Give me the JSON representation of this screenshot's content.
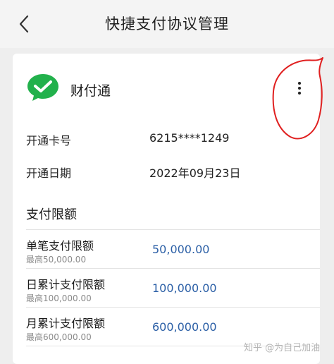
{
  "header": {
    "title": "快捷支付协议管理"
  },
  "provider": {
    "name": "财付通"
  },
  "info": [
    {
      "label": "开通卡号",
      "value": "6215****1249"
    },
    {
      "label": "开通日期",
      "value": "2022年09月23日"
    }
  ],
  "limits": {
    "section_title": "支付限额",
    "rows": [
      {
        "name": "单笔支付限额",
        "max": "最高50,000.00",
        "value": "50,000.00"
      },
      {
        "name": "日累计支付限额",
        "max": "最高100,000.00",
        "value": "100,000.00"
      },
      {
        "name": "月累计支付限额",
        "max": "最高600,000.00",
        "value": "600,000.00"
      }
    ]
  },
  "watermark": "知乎 @为自己加油",
  "colors": {
    "wechat_green": "#22b14c",
    "limit_value": "#2b5fa6",
    "annotation": "#e02020"
  },
  "icons": [
    "back-arrow-icon",
    "wechat-pay-icon",
    "more-vertical-icon"
  ]
}
